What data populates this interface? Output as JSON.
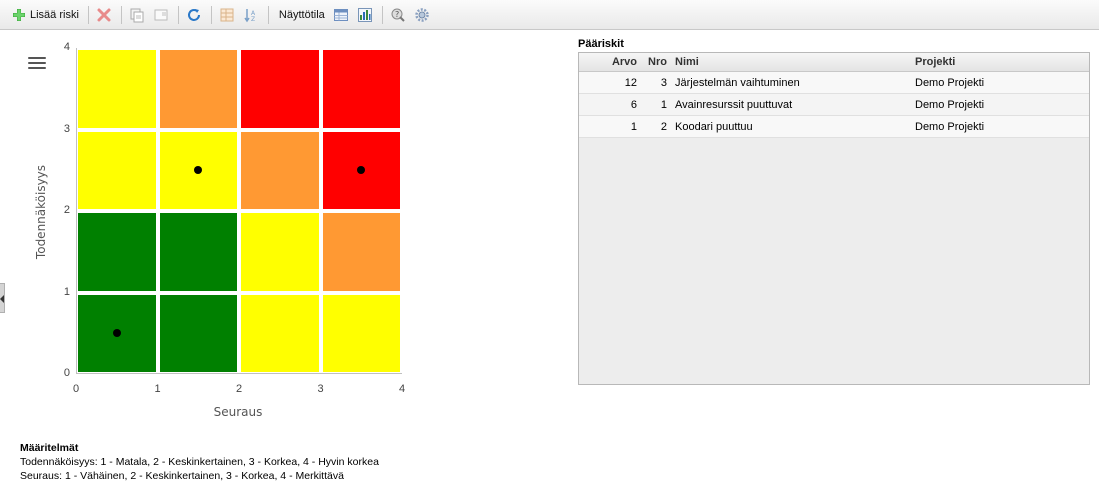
{
  "toolbar": {
    "add_risk_label": "Lisää riski",
    "view_mode_label": "Näyttötila",
    "icons": [
      "add-icon",
      "delete-icon",
      "copy-icon",
      "export-icon",
      "refresh-icon",
      "table-icon",
      "sort-icon",
      "grid-view-icon",
      "chart-view-icon",
      "help-icon",
      "settings-icon"
    ]
  },
  "chart_data": {
    "type": "heatmap",
    "xlabel": "Seuraus",
    "ylabel": "Todennäköisyys",
    "xlim": [
      0,
      4
    ],
    "ylim": [
      0,
      4
    ],
    "x_ticks": [
      "0",
      "1",
      "2",
      "3",
      "4"
    ],
    "y_ticks": [
      "0",
      "1",
      "2",
      "3",
      "4"
    ],
    "colors": {
      "green": "#008000",
      "yellow": "#ffff00",
      "orange": "#ff9933",
      "red": "#ff0000"
    },
    "cells_by_row_top_to_bottom": [
      [
        "yellow",
        "orange",
        "red",
        "red"
      ],
      [
        "yellow",
        "yellow",
        "orange",
        "red"
      ],
      [
        "green",
        "green",
        "yellow",
        "orange"
      ],
      [
        "green",
        "green",
        "yellow",
        "yellow"
      ]
    ],
    "points": [
      {
        "x": 1.5,
        "y": 2.5
      },
      {
        "x": 3.5,
        "y": 2.5
      },
      {
        "x": 0.5,
        "y": 0.5
      }
    ]
  },
  "definitions": {
    "title": "Määritelmät",
    "likelihood": "Todennäköisyys: 1 - Matala, 2 - Keskinkertainen, 3 - Korkea, 4 - Hyvin korkea",
    "consequence": "Seuraus: 1 - Vähäinen, 2 - Keskinkertainen, 3 - Korkea, 4 - Merkittävä"
  },
  "main_risks": {
    "title": "Pääriskit",
    "columns": [
      "Arvo",
      "Nro",
      "Nimi",
      "Projekti"
    ],
    "rows": [
      {
        "arvo": "12",
        "nro": "3",
        "nimi": "Järjestelmän vaihtuminen",
        "projekti": "Demo Projekti"
      },
      {
        "arvo": "6",
        "nro": "1",
        "nimi": "Avainresurssit puuttuvat",
        "projekti": "Demo Projekti"
      },
      {
        "arvo": "1",
        "nro": "2",
        "nimi": "Koodari puuttuu",
        "projekti": "Demo Projekti"
      }
    ]
  }
}
